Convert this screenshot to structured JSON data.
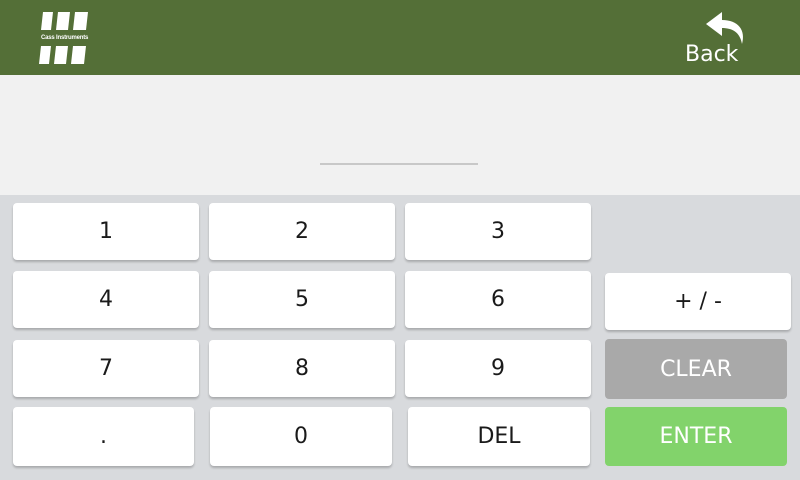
{
  "header": {
    "logo_text": "Cass Instruments",
    "back_label": "Back",
    "background": "#546f37"
  },
  "display": {
    "value": ""
  },
  "keypad": {
    "k1": "1",
    "k2": "2",
    "k3": "3",
    "k4": "4",
    "k5": "5",
    "k6": "6",
    "k7": "7",
    "k8": "8",
    "k9": "9",
    "kdot": ".",
    "k0": "0",
    "del": "DEL",
    "sign": "+ / -",
    "clear": "CLEAR",
    "enter": "ENTER"
  },
  "colors": {
    "clear": "#a9a9a9",
    "enter": "#82d36b"
  }
}
